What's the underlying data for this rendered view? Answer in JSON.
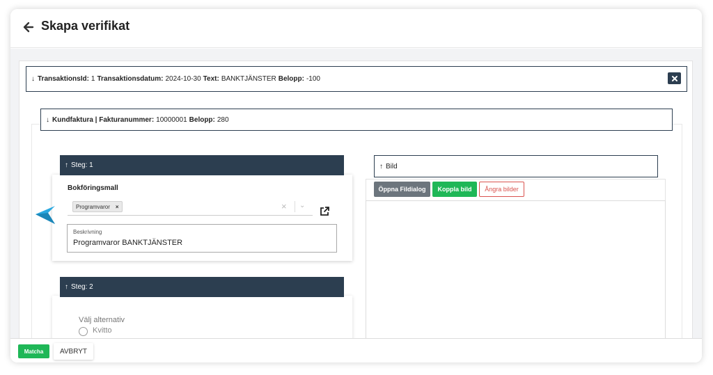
{
  "header": {
    "title": "Skapa verifikat"
  },
  "transaction": {
    "id_label": "TransaktionsId:",
    "id_value": "1",
    "date_label": "Transaktionsdatum:",
    "date_value": "2024-10-30",
    "text_label": "Text:",
    "text_value": "BANKTJÄNSTER",
    "amount_label": "Belopp:",
    "amount_value": "-100"
  },
  "invoice": {
    "type_label": "Kundfaktura | Fakturanummer:",
    "number_value": "10000001",
    "amount_label": "Belopp:",
    "amount_value": "280"
  },
  "step1": {
    "title": "Steg: 1",
    "template_label": "Bokföringsmall",
    "template_chip": "Programvaror",
    "description_label": "Beskrivning",
    "description_value": "Programvaror BANKTJÄNSTER"
  },
  "step2": {
    "title": "Steg: 2",
    "prompt": "Välj alternativ",
    "options": [
      "Kvitto"
    ]
  },
  "image_panel": {
    "title": "Bild",
    "open_dialog_label": "Öppna Fildialog",
    "link_image_label": "Koppla bild",
    "undo_images_label": "Ångra bilder"
  },
  "footer": {
    "match_label": "Matcha",
    "cancel_label": "AVBRYT"
  },
  "colors": {
    "dark": "#2c3e50",
    "green": "#1fb757",
    "grey": "#6c757d",
    "red": "#d9534f",
    "pointer": "#29a8e0"
  }
}
